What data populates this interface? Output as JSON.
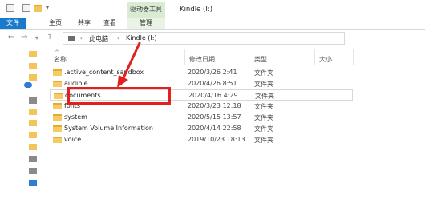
{
  "titlebar": {
    "drive_tools_label": "驱动器工具",
    "window_title": "Kindle (I:)"
  },
  "ribbon": {
    "tabs": [
      "文件",
      "主页",
      "共享",
      "查看",
      "管理"
    ]
  },
  "address": {
    "crumbs": [
      "此电脑",
      "Kindle (I:)"
    ]
  },
  "columns": {
    "name": "名称",
    "modified": "修改日期",
    "type": "类型",
    "size": "大小"
  },
  "files": [
    {
      "name": ".active_content_sandbox",
      "modified": "2020/3/26 2:41",
      "type": "文件夹"
    },
    {
      "name": "audible",
      "modified": "2020/4/26 8:51",
      "type": "文件夹"
    },
    {
      "name": "documents",
      "modified": "2020/4/16 4:29",
      "type": "文件夹"
    },
    {
      "name": "fonts",
      "modified": "2020/3/23 12:18",
      "type": "文件夹"
    },
    {
      "name": "system",
      "modified": "2020/5/15 13:57",
      "type": "文件夹"
    },
    {
      "name": "System Volume Information",
      "modified": "2020/4/14 22:58",
      "type": "文件夹"
    },
    {
      "name": "voice",
      "modified": "2019/10/23 18:13",
      "type": "文件夹"
    }
  ],
  "colors": {
    "accent": "#1979ca",
    "selection": "#cce8ff",
    "annotation": "#e32020"
  }
}
